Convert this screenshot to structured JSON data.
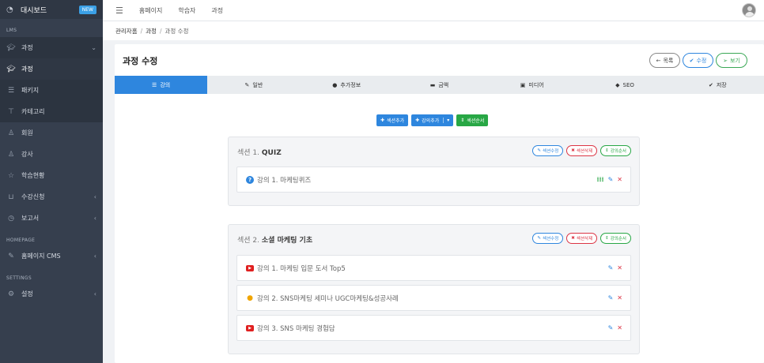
{
  "sidebar": {
    "dashboard": {
      "label": "대시보드",
      "badge": "NEW",
      "icon": "dashboard-icon"
    },
    "section_lms": "LMS",
    "course_group": {
      "label": "과정",
      "icon": "graduation-cap-icon"
    },
    "items": [
      {
        "label": "과정",
        "icon": "graduation-cap-icon"
      },
      {
        "label": "패키지",
        "icon": "list-icon"
      },
      {
        "label": "카테고리",
        "icon": "sitemap-icon"
      },
      {
        "label": "회원",
        "icon": "user-icon"
      },
      {
        "label": "강사",
        "icon": "user-plus-icon"
      },
      {
        "label": "학습현황",
        "icon": "star-icon"
      },
      {
        "label": "수강신청",
        "icon": "cart-icon"
      },
      {
        "label": "보고서",
        "icon": "clock-icon"
      }
    ],
    "section_homepage": "HOMEPAGE",
    "homepage_cms": {
      "label": "홈페이지 CMS",
      "icon": "puzzle-icon"
    },
    "section_settings": "SETTINGS",
    "settings": {
      "label": "설정",
      "icon": "gear-icon"
    }
  },
  "topbar": {
    "nav": [
      "홈페이지",
      "학습자",
      "과정"
    ]
  },
  "breadcrumb": {
    "root": "관리자홈",
    "mid": "과정",
    "current": "과정 수정"
  },
  "page": {
    "title": "과정 수정",
    "buttons": {
      "list": "목록",
      "edit": "수정",
      "view": "보기"
    }
  },
  "tabs": [
    {
      "label": "강의",
      "icon": "list-icon"
    },
    {
      "label": "일반",
      "icon": "pencil-icon"
    },
    {
      "label": "추가정보",
      "icon": "bell-icon"
    },
    {
      "label": "금액",
      "icon": "credit-card-icon"
    },
    {
      "label": "미디어",
      "icon": "film-icon"
    },
    {
      "label": "SEO",
      "icon": "tag-icon"
    },
    {
      "label": "저장",
      "icon": "check-circle-icon"
    }
  ],
  "actions": {
    "add_section": "섹션추가",
    "add_lecture": "강의추가",
    "section_order": "섹션순서"
  },
  "section_buttons": {
    "edit": "섹션수정",
    "delete": "섹션삭제",
    "order": "강의순서"
  },
  "sections": [
    {
      "prefix": "섹션 1.",
      "name": "QUIZ",
      "lectures": [
        {
          "label": "강의 1. 마케팅퀴즈",
          "type": "quiz"
        }
      ]
    },
    {
      "prefix": "섹션 2.",
      "name": "소셜 마케팅 기초",
      "lectures": [
        {
          "label": "강의 1. 마케팅 입문 도서 Top5",
          "type": "youtube"
        },
        {
          "label": "강의 2. SNS마케팅 세미나 UGC마케팅&성공사례",
          "type": "link"
        },
        {
          "label": "강의 3. SNS 마케팅 경험담",
          "type": "youtube"
        }
      ]
    }
  ],
  "colors": {
    "primary": "#2e86de",
    "success": "#28a745",
    "danger": "#dc3545",
    "sidebar": "#363f4e"
  }
}
